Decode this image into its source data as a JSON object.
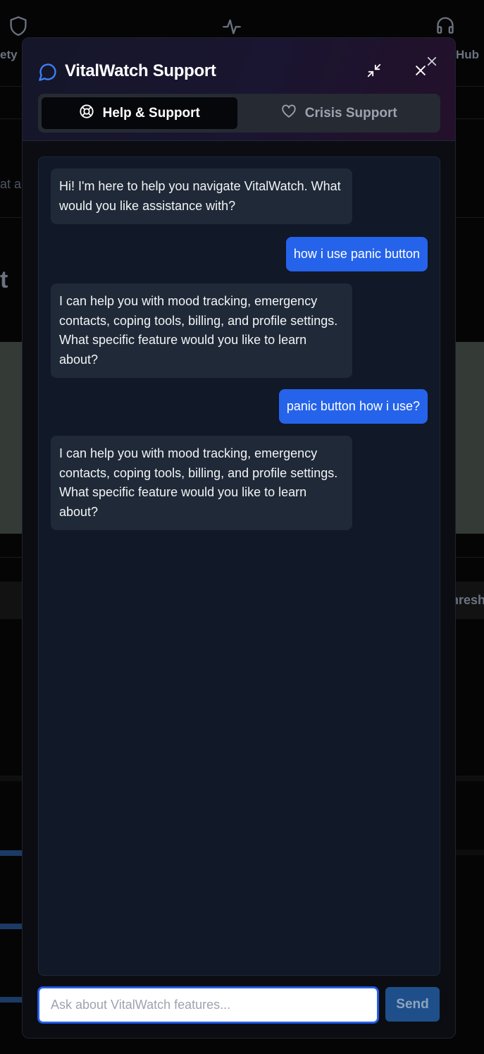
{
  "background": {
    "nav_left_label": "ety",
    "nav_right_label": "Hub",
    "side_text_1": "at a",
    "side_text_2": "t",
    "side_text_3": "nresh"
  },
  "dialog": {
    "title": "VitalWatch Support",
    "title_icon": "chat-bubble-icon",
    "tabs": [
      {
        "label": "Help & Support",
        "icon": "lifebuoy-icon",
        "active": true
      },
      {
        "label": "Crisis Support",
        "icon": "heart-icon",
        "active": false
      }
    ],
    "messages": [
      {
        "role": "bot",
        "text": "Hi! I'm here to help you navigate VitalWatch. What would you like assistance with?"
      },
      {
        "role": "user",
        "text": "how i use panic button"
      },
      {
        "role": "bot",
        "text": "I can help you with mood tracking, emergency contacts, coping tools, billing, and profile settings. What specific feature would you like to learn about?"
      },
      {
        "role": "user",
        "text": "panic button how i use?"
      },
      {
        "role": "bot",
        "text": "I can help you with mood tracking, emergency contacts, coping tools, billing, and profile settings. What specific feature would you like to learn about?"
      }
    ],
    "input_placeholder": "Ask about VitalWatch features...",
    "input_value": "",
    "send_label": "Send"
  },
  "colors": {
    "accent": "#2563eb",
    "dialog_bg": "#0b0d12",
    "chat_bg": "#111827",
    "bot_bubble": "#1f2937"
  }
}
